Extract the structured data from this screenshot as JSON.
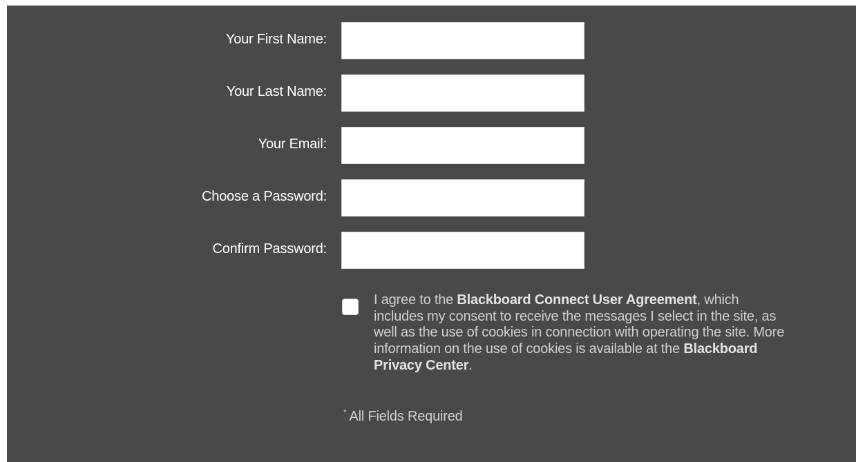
{
  "form": {
    "fields": [
      {
        "label": "Your First Name:",
        "value": "",
        "type": "text"
      },
      {
        "label": "Your Last Name:",
        "value": "",
        "type": "text"
      },
      {
        "label": "Your Email:",
        "value": "",
        "type": "email"
      },
      {
        "label": "Choose a Password:",
        "value": "",
        "type": "password"
      },
      {
        "label": "Confirm Password:",
        "value": "",
        "type": "password"
      }
    ],
    "agreement": {
      "checked": false,
      "text_before": "I agree to the ",
      "user_agreement_link": "Blackboard Connect User Agreement",
      "text_middle": ", which includes my consent to receive the messages I select in the site, as well as the use of cookies in connection with operating the site. More information on the use of cookies is available at the ",
      "privacy_link": "Blackboard Privacy Center",
      "text_after": "."
    },
    "required_note": {
      "asterisk": "*",
      "text": "All Fields Required"
    }
  },
  "colors": {
    "panel_background": "#4a4948",
    "label_text": "#ffffff",
    "agreement_text": "#cfcfcf",
    "input_background": "#ffffff"
  }
}
